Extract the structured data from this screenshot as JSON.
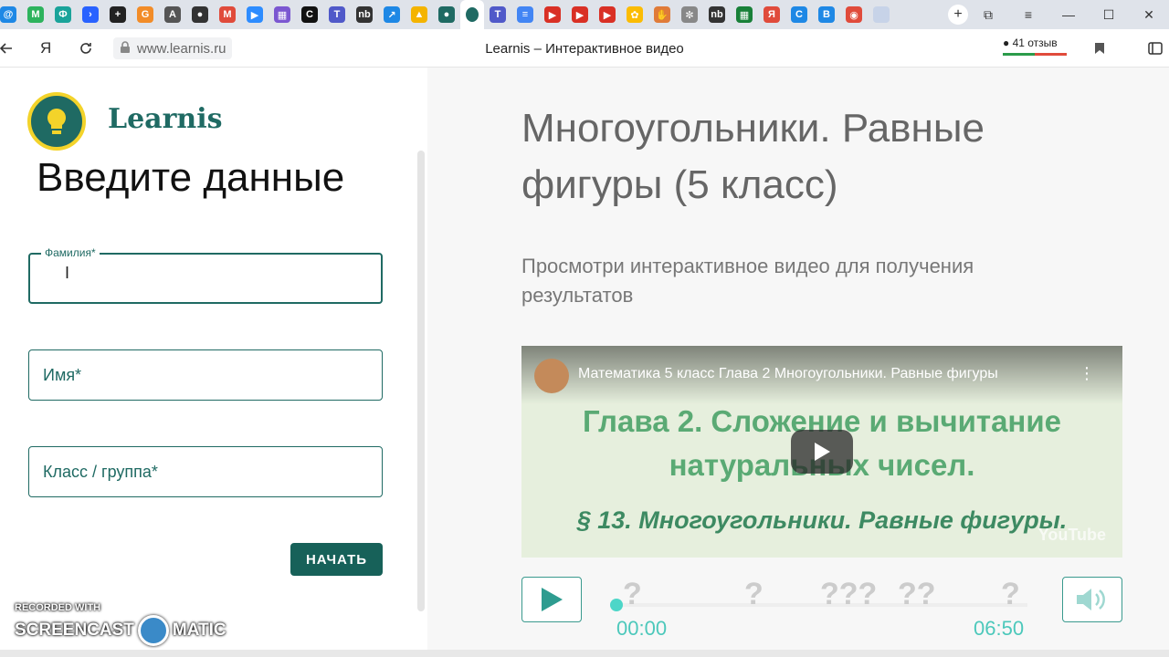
{
  "browser": {
    "url": "www.learnis.ru",
    "page_title": "Learnis – Интерактивное видео",
    "reviews": "41 отзыв",
    "yandex_letter": "Я",
    "new_tab": "+",
    "window": {
      "minimize": "—",
      "maximize": "☐",
      "close": "✕",
      "menu": "≡",
      "bookmarks": "⧉"
    }
  },
  "tabs": {
    "icons": [
      {
        "name": "tab-mail-icon",
        "color": "#1e88e5",
        "glyph": "@"
      },
      {
        "name": "tab-m-icon",
        "color": "#2db35d",
        "glyph": "M"
      },
      {
        "name": "tab-app-icon",
        "color": "#1aa39a",
        "glyph": "Ф"
      },
      {
        "name": "tab-arrow-icon",
        "color": "#2962ff",
        "glyph": "›"
      },
      {
        "name": "tab-plus-icon",
        "color": "#222",
        "glyph": "+"
      },
      {
        "name": "tab-g-icon",
        "color": "#f28c28",
        "glyph": "G"
      },
      {
        "name": "tab-a-icon",
        "color": "#555",
        "glyph": "A"
      },
      {
        "name": "tab-dot-icon",
        "color": "#333",
        "glyph": "●"
      },
      {
        "name": "tab-gmail-icon",
        "color": "#e04b3b",
        "glyph": "M"
      },
      {
        "name": "tab-zoom-icon",
        "color": "#2d8cff",
        "glyph": "▶"
      },
      {
        "name": "tab-puzzle-icon",
        "color": "#7b57d1",
        "glyph": "▦"
      },
      {
        "name": "tab-c-icon",
        "color": "#111",
        "glyph": "C"
      },
      {
        "name": "tab-teams-icon",
        "color": "#5059c9",
        "glyph": "T"
      },
      {
        "name": "tab-nb-icon",
        "color": "#333",
        "glyph": "nb"
      },
      {
        "name": "tab-arrow2-icon",
        "color": "#1e88e5",
        "glyph": "↗"
      },
      {
        "name": "tab-drive-icon",
        "color": "#f4b400",
        "glyph": "▲"
      },
      {
        "name": "tab-learnis-icon",
        "color": "#1f6a63",
        "glyph": "●"
      }
    ],
    "icons_after": [
      {
        "name": "tab-teams2-icon",
        "color": "#5059c9",
        "glyph": "T"
      },
      {
        "name": "tab-docs-icon",
        "color": "#4285f4",
        "glyph": "≡"
      },
      {
        "name": "tab-youtube-icon",
        "color": "#d93025",
        "glyph": "▶"
      },
      {
        "name": "tab-youtube2-icon",
        "color": "#d93025",
        "glyph": "▶"
      },
      {
        "name": "tab-youtube3-icon",
        "color": "#d93025",
        "glyph": "▶"
      },
      {
        "name": "tab-photos-icon",
        "color": "#fbbc04",
        "glyph": "✿"
      },
      {
        "name": "tab-hands-icon",
        "color": "#e07b39",
        "glyph": "✋"
      },
      {
        "name": "tab-flower-icon",
        "color": "#888",
        "glyph": "✼"
      },
      {
        "name": "tab-nb2-icon",
        "color": "#333",
        "glyph": "nb"
      },
      {
        "name": "tab-sheet-icon",
        "color": "#188038",
        "glyph": "▦"
      },
      {
        "name": "tab-yandex-icon",
        "color": "#e04b3b",
        "glyph": "Я"
      },
      {
        "name": "tab-c2-icon",
        "color": "#1e88e5",
        "glyph": "C"
      },
      {
        "name": "tab-b-icon",
        "color": "#1e88e5",
        "glyph": "B"
      },
      {
        "name": "tab-chrome-icon",
        "color": "#e04b3b",
        "glyph": "◉"
      },
      {
        "name": "tab-blank-icon",
        "color": "#c7d3e8",
        "glyph": ""
      }
    ]
  },
  "brand": {
    "name": "Learnis"
  },
  "form": {
    "title": "Введите данные",
    "surname_label": "Фамилия*",
    "name_placeholder": "Имя*",
    "class_placeholder": "Класс / группа*",
    "start_button": "НАЧАТЬ"
  },
  "lesson": {
    "title": "Многоугольники. Равные фигуры (5 класс)",
    "subtitle": "Просмотри интерактивное видео для получения результатов"
  },
  "video": {
    "yt_title": "Математика 5 класс Глава 2 Многоугольники. Равные фигуры",
    "slide_line1": "Глава 2. Сложение и вычитание",
    "slide_line2": "натуральных чисел.",
    "slide_line3": "§ 13. Многоугольники. Равные фигуры.",
    "yt_logo": "YouTube",
    "menu": "⋮"
  },
  "player": {
    "current_time": "00:00",
    "duration": "06:50",
    "progress": 0,
    "markers": [
      "?",
      "?",
      "???",
      "??",
      "?"
    ]
  },
  "watermark": {
    "line1": "RECORDED WITH",
    "left": "SCREENCAST",
    "right": "MATIC"
  }
}
